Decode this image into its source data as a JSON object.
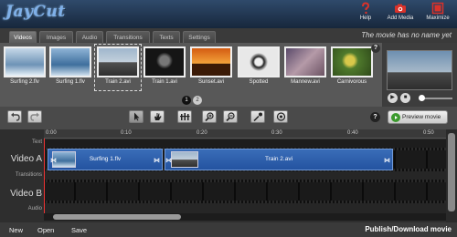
{
  "app": {
    "logo": "JayCut"
  },
  "header": {
    "buttons": [
      {
        "label": "Help",
        "icon": "help-icon"
      },
      {
        "label": "Add Media",
        "icon": "camera-icon"
      },
      {
        "label": "Maximize",
        "icon": "maximize-icon"
      }
    ]
  },
  "tabs": [
    "Videos",
    "Images",
    "Audio",
    "Transitions",
    "Texts",
    "Settings"
  ],
  "active_tab": "Videos",
  "movie_name": "The movie has no name yet",
  "media": {
    "clips": [
      "Surfing 2.flv",
      "Surfing 1.flv",
      "Train 2.avi",
      "Train 1.avi",
      "Sunset.avi",
      "Spotted",
      "Mannew.avi",
      "Carnivorous"
    ],
    "selected": "Train 2.avi",
    "pages": [
      "1",
      "2"
    ],
    "help": "?"
  },
  "preview": {
    "play": "▶",
    "stop": "■",
    "position": 0.0
  },
  "toolbar": {
    "help": "?",
    "preview_movie": "Preview movie",
    "tools": [
      "undo-icon",
      "redo-icon",
      "select-icon",
      "hand-icon",
      "split-icon",
      "zoom-in-icon",
      "zoom-out-icon",
      "pipette-icon",
      "options-icon"
    ]
  },
  "timeline": {
    "ruler": [
      "0:00",
      "0:10",
      "0:20",
      "0:30",
      "0:40",
      "0:50"
    ],
    "tracks": {
      "text": "Text",
      "video_a": "Video A",
      "transitions": "Transitions",
      "video_b": "Video B",
      "audio": "Audio"
    },
    "clips": [
      {
        "label": "Surfing 1.flv",
        "track": "Video A"
      },
      {
        "label": "Train 2.avi",
        "track": "Video A"
      }
    ]
  },
  "bottom": {
    "new": "New",
    "open": "Open",
    "save": "Save",
    "publish": "Publish/Download movie"
  },
  "colors": {
    "clip_blue": "#2f5fae",
    "header_dark": "#17273c",
    "preview_green": "#3c9a2e"
  }
}
